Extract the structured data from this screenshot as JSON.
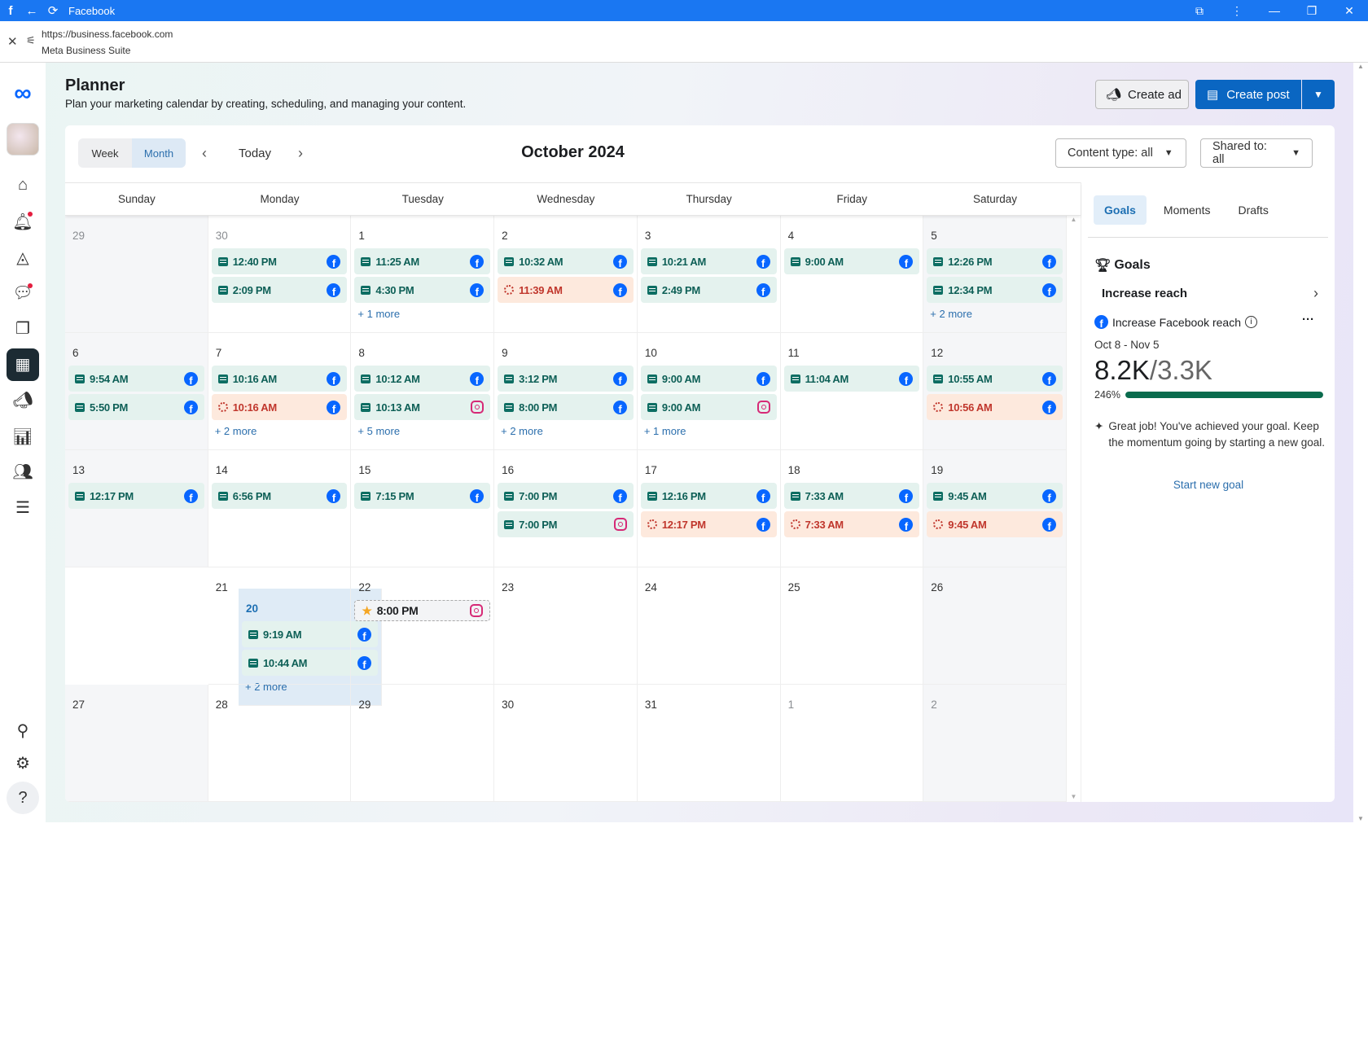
{
  "browser": {
    "title": "Facebook",
    "url": "https://business.facebook.com",
    "page_title": "Meta Business Suite"
  },
  "sidebar": {
    "items": [
      {
        "name": "meta-logo",
        "glyph": "∞"
      },
      {
        "name": "home",
        "glyph": "⌂"
      },
      {
        "name": "notifications",
        "glyph": "🔔︎"
      },
      {
        "name": "explore",
        "glyph": "◬"
      },
      {
        "name": "inbox",
        "glyph": "💬︎"
      },
      {
        "name": "content",
        "glyph": "❐"
      },
      {
        "name": "planner",
        "glyph": "▦"
      },
      {
        "name": "ads",
        "glyph": "📣︎"
      },
      {
        "name": "insights",
        "glyph": "📊︎"
      },
      {
        "name": "audience",
        "glyph": "👥︎"
      },
      {
        "name": "menu",
        "glyph": "☰"
      },
      {
        "name": "search",
        "glyph": "⚲"
      },
      {
        "name": "settings",
        "glyph": "⚙"
      },
      {
        "name": "help",
        "glyph": "?"
      }
    ]
  },
  "header": {
    "title": "Planner",
    "subtitle": "Plan your marketing calendar by creating, scheduling, and managing your content.",
    "create_ad": "Create ad",
    "create_post": "Create post"
  },
  "toolbar": {
    "week": "Week",
    "month": "Month",
    "today": "Today",
    "month_title": "October 2024",
    "content_type": "Content type: all",
    "shared_to": "Shared to: all"
  },
  "weekdays": [
    "Sunday",
    "Monday",
    "Tuesday",
    "Wednesday",
    "Thursday",
    "Friday",
    "Saturday"
  ],
  "weeks": [
    [
      {
        "day": "29",
        "muted": true,
        "events": []
      },
      {
        "day": "30",
        "muted": true,
        "events": [
          {
            "time": "12:40 PM",
            "type": "post",
            "platform": "fb"
          },
          {
            "time": "2:09 PM",
            "type": "post",
            "platform": "fb"
          }
        ]
      },
      {
        "day": "1",
        "events": [
          {
            "time": "11:25 AM",
            "type": "post",
            "platform": "fb"
          },
          {
            "time": "4:30 PM",
            "type": "post",
            "platform": "fb"
          }
        ],
        "more": "+ 1 more"
      },
      {
        "day": "2",
        "events": [
          {
            "time": "10:32 AM",
            "type": "post",
            "platform": "fb"
          },
          {
            "time": "11:39 AM",
            "type": "pending",
            "platform": "fb"
          }
        ]
      },
      {
        "day": "3",
        "events": [
          {
            "time": "10:21 AM",
            "type": "post",
            "platform": "fb"
          },
          {
            "time": "2:49 PM",
            "type": "post",
            "platform": "fb"
          }
        ]
      },
      {
        "day": "4",
        "events": [
          {
            "time": "9:00 AM",
            "type": "post",
            "platform": "fb"
          }
        ]
      },
      {
        "day": "5",
        "events": [
          {
            "time": "12:26 PM",
            "type": "post",
            "platform": "fb"
          },
          {
            "time": "12:34 PM",
            "type": "post",
            "platform": "fb"
          }
        ],
        "more": "+ 2 more"
      }
    ],
    [
      {
        "day": "6",
        "events": [
          {
            "time": "9:54 AM",
            "type": "post",
            "platform": "fb"
          },
          {
            "time": "5:50 PM",
            "type": "post",
            "platform": "fb"
          }
        ]
      },
      {
        "day": "7",
        "events": [
          {
            "time": "10:16 AM",
            "type": "post",
            "platform": "fb"
          },
          {
            "time": "10:16 AM",
            "type": "pending",
            "platform": "fb"
          }
        ],
        "more": "+ 2 more"
      },
      {
        "day": "8",
        "events": [
          {
            "time": "10:12 AM",
            "type": "post",
            "platform": "fb"
          },
          {
            "time": "10:13 AM",
            "type": "post",
            "platform": "ig"
          }
        ],
        "more": "+ 5 more"
      },
      {
        "day": "9",
        "events": [
          {
            "time": "3:12 PM",
            "type": "post",
            "platform": "fb"
          },
          {
            "time": "8:00 PM",
            "type": "post",
            "platform": "fb"
          }
        ],
        "more": "+ 2 more"
      },
      {
        "day": "10",
        "events": [
          {
            "time": "9:00 AM",
            "type": "post",
            "platform": "fb"
          },
          {
            "time": "9:00 AM",
            "type": "post",
            "platform": "ig"
          }
        ],
        "more": "+ 1 more"
      },
      {
        "day": "11",
        "events": [
          {
            "time": "11:04 AM",
            "type": "post",
            "platform": "fb"
          }
        ]
      },
      {
        "day": "12",
        "events": [
          {
            "time": "10:55 AM",
            "type": "post",
            "platform": "fb"
          },
          {
            "time": "10:56 AM",
            "type": "pending",
            "platform": "fb"
          }
        ]
      }
    ],
    [
      {
        "day": "13",
        "events": [
          {
            "time": "12:17 PM",
            "type": "post",
            "platform": "fb"
          }
        ]
      },
      {
        "day": "14",
        "events": [
          {
            "time": "6:56 PM",
            "type": "post",
            "platform": "fb"
          }
        ]
      },
      {
        "day": "15",
        "events": [
          {
            "time": "7:15 PM",
            "type": "post",
            "platform": "fb"
          }
        ]
      },
      {
        "day": "16",
        "events": [
          {
            "time": "7:00 PM",
            "type": "post",
            "platform": "fb"
          },
          {
            "time": "7:00 PM",
            "type": "post",
            "platform": "ig"
          }
        ]
      },
      {
        "day": "17",
        "events": [
          {
            "time": "12:16 PM",
            "type": "post",
            "platform": "fb"
          },
          {
            "time": "12:17 PM",
            "type": "pending",
            "platform": "fb"
          }
        ]
      },
      {
        "day": "18",
        "events": [
          {
            "time": "7:33 AM",
            "type": "post",
            "platform": "fb"
          },
          {
            "time": "7:33 AM",
            "type": "pending",
            "platform": "fb"
          }
        ]
      },
      {
        "day": "19",
        "events": [
          {
            "time": "9:45 AM",
            "type": "post",
            "platform": "fb"
          },
          {
            "time": "9:45 AM",
            "type": "pending",
            "platform": "fb"
          }
        ]
      }
    ],
    [
      {
        "day": "20",
        "today": true,
        "events": [
          {
            "time": "9:19 AM",
            "type": "post",
            "platform": "fb"
          },
          {
            "time": "10:44 AM",
            "type": "post",
            "platform": "fb"
          }
        ],
        "more": "+ 2 more"
      },
      {
        "day": "21",
        "events": []
      },
      {
        "day": "22",
        "events": [
          {
            "time": "8:00 PM",
            "type": "moment",
            "platform": "ig"
          }
        ]
      },
      {
        "day": "23",
        "events": []
      },
      {
        "day": "24",
        "events": []
      },
      {
        "day": "25",
        "events": []
      },
      {
        "day": "26",
        "events": []
      }
    ],
    [
      {
        "day": "27",
        "events": []
      },
      {
        "day": "28",
        "events": []
      },
      {
        "day": "29",
        "events": []
      },
      {
        "day": "30",
        "events": []
      },
      {
        "day": "31",
        "events": []
      },
      {
        "day": "1",
        "muted": true,
        "events": []
      },
      {
        "day": "2",
        "muted": true,
        "events": []
      }
    ]
  ],
  "panel": {
    "tabs": [
      "Goals",
      "Moments",
      "Drafts"
    ],
    "heading": "Goals",
    "goal_name": "Increase reach",
    "goal_metric": "Increase Facebook reach",
    "range": "Oct 8 - Nov 5",
    "current": "8.2K",
    "separator": "/",
    "target": "3.3K",
    "percent_label": "246%",
    "progress": 1.0,
    "message": "Great job! You've achieved your goal. Keep the momentum going by starting a new goal.",
    "start_new": "Start new goal"
  },
  "colors": {
    "brand": "#1a77f2",
    "primary": "#0a66c2",
    "post_bg": "#e4f2ee",
    "post_text": "#0d5f56",
    "pending_bg": "#fde9dd",
    "pending_text": "#c0362c",
    "progress": "#0a6b4d"
  }
}
